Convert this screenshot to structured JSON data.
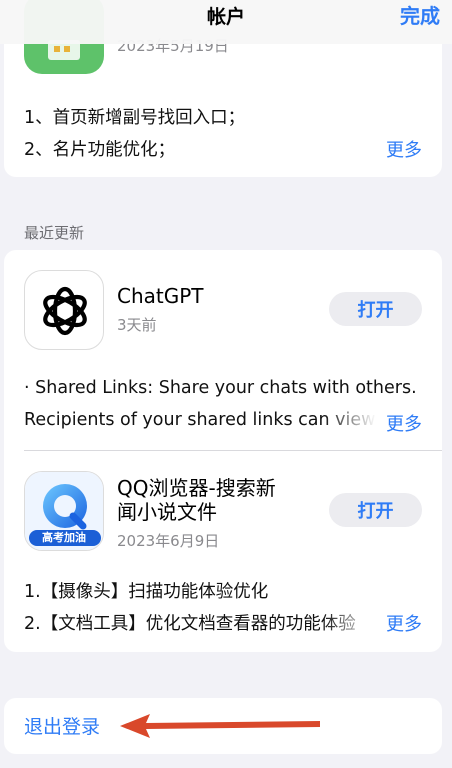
{
  "navbar": {
    "title": "帐户",
    "done_label": "完成"
  },
  "prev_app": {
    "date": "2023年5月19日",
    "notes": [
      "1、首页新增副号找回入口；",
      "2、名片功能优化；"
    ],
    "more_label": "更多",
    "icon": "wechat-like-green-icon",
    "icon_color": "#5ec26a"
  },
  "section": {
    "recent_updates": "最近更新"
  },
  "apps": [
    {
      "name": "ChatGPT",
      "date": "3天前",
      "open_label": "打开",
      "icon": "openai-knot-icon",
      "notes": [
        "· Shared Links: Share your chats with others.",
        "Recipients of your shared links can view"
      ],
      "more_label": "更多"
    },
    {
      "name_line1": "QQ浏览器-搜索新",
      "name_line2": "闻小说文件",
      "date": "2023年6月9日",
      "open_label": "打开",
      "icon": "qq-browser-icon",
      "icon_badge": "高考加油",
      "notes": [
        "1.【摄像头】扫描功能体验优化",
        "2.【文档工具】优化文档查看器的功能体验"
      ],
      "more_label": "更多"
    }
  ],
  "logout": {
    "label": "退出登录"
  },
  "colors": {
    "accent": "#2f7cf6",
    "arrow": "#d9482b"
  }
}
